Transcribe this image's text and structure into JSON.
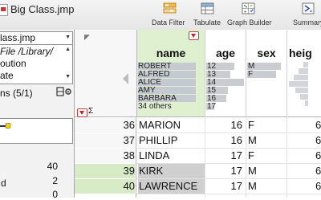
{
  "window": {
    "title": "Big Class.jmp"
  },
  "toolbar": {
    "buttons": [
      {
        "label": "Data Filter"
      },
      {
        "label": "Tabulate"
      },
      {
        "label": "Graph Builder"
      },
      {
        "label": "Summary"
      }
    ]
  },
  "left_panel": {
    "table_name": "lass.jmp",
    "notes_lines": [
      "File /Library/",
      "oution",
      "ate"
    ],
    "columns_header": "ns (5/1)",
    "rows_counts": [
      {
        "label": "",
        "value": "40"
      },
      {
        "label": "d",
        "value": "2"
      },
      {
        "label": "",
        "value": "0"
      }
    ]
  },
  "columns": [
    {
      "name": "name",
      "selected": true,
      "distribution": [
        "ROBERT",
        "ALFRED",
        "ALICE",
        "AMY",
        "BARBARA",
        "34 others"
      ]
    },
    {
      "name": "age",
      "selected": false,
      "distribution": [
        "12",
        "13",
        "14",
        "15",
        "16",
        "17"
      ],
      "bar_fractions": [
        0.7,
        0.6,
        0.95,
        0.55,
        0.5,
        0.2
      ]
    },
    {
      "name": "sex",
      "selected": false,
      "distribution": [
        "M",
        "F"
      ],
      "bar_fractions": [
        0.85,
        0.72
      ]
    },
    {
      "name": "heig",
      "selected": false
    }
  ],
  "rows": [
    {
      "num": "36",
      "name": "MARION",
      "age": "16",
      "sex": "F",
      "height": "6",
      "selected": false
    },
    {
      "num": "37",
      "name": "PHILLIP",
      "age": "16",
      "sex": "M",
      "height": "6",
      "selected": false
    },
    {
      "num": "38",
      "name": "LINDA",
      "age": "17",
      "sex": "F",
      "height": "6",
      "selected": false
    },
    {
      "num": "39",
      "name": "KIRK",
      "age": "17",
      "sex": "M",
      "height": "6",
      "selected": true
    },
    {
      "num": "40",
      "name": "LAWRENCE",
      "age": "17",
      "sex": "M",
      "height": "6",
      "selected": true
    }
  ],
  "colors": {
    "selected_header": "#dff0d0",
    "selected_row": "#d7ecc6",
    "red_triangle": "#cc2222"
  }
}
